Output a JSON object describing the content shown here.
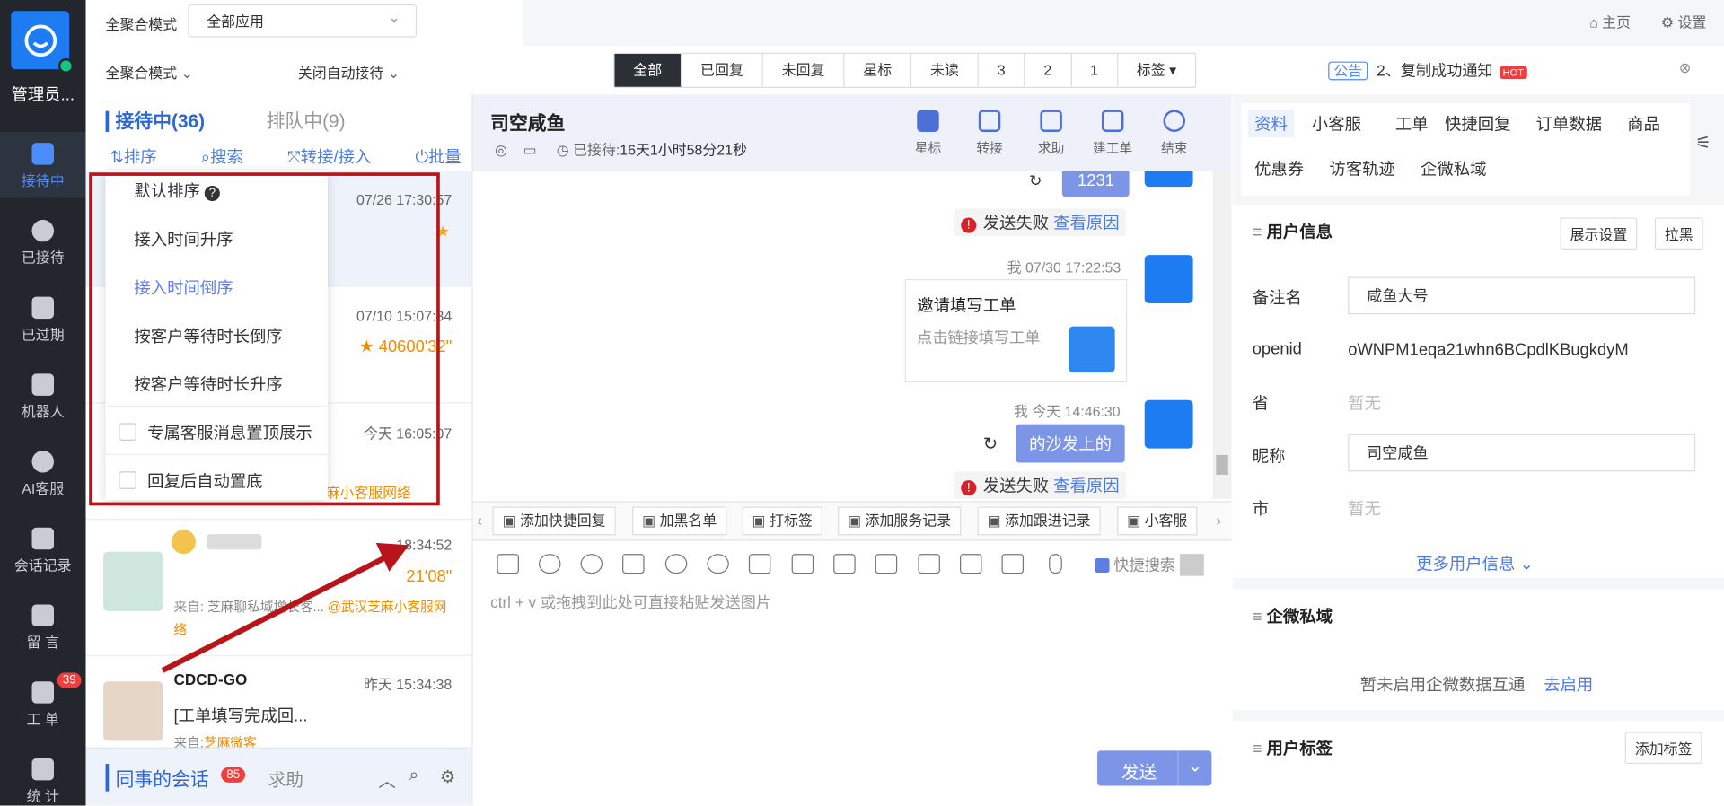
{
  "nav": {
    "admin": "管理员...",
    "items": [
      "接待中",
      "已接待",
      "已过期",
      "机器人",
      "AI客服",
      "会话记录",
      "留 言",
      "工 单",
      "统 计"
    ],
    "badge": "39"
  },
  "top": {
    "mode_label": "全聚合模式",
    "app_select": "全部应用",
    "home": "主页",
    "settings": "设置"
  },
  "row2": {
    "mode": "全聚合模式",
    "auto": "关闭自动接待",
    "filters": [
      "全部",
      "已回复",
      "未回复",
      "星标",
      "未读",
      "3",
      "2",
      "1",
      "标签 ▾"
    ],
    "notice_tag": "公告",
    "notice_text": "2、复制成功通知",
    "notice_hot": "HOT"
  },
  "list": {
    "tab_active": "接待中(36)",
    "tab_queue": "排队中(9)",
    "tools": [
      "排序",
      "搜索",
      "转接/接入",
      "批量结束"
    ],
    "sessions": [
      {
        "time": "07/26 17:30:57"
      },
      {
        "time": "07/10 15:07:34",
        "extra": "40600'32\""
      },
      {
        "time": "今天 16:05:07",
        "src_tail": "麻小客服网络"
      },
      {
        "time": "18:34:52",
        "extra": "21'08\"",
        "src": "来自: 芝麻聊私域增长客...",
        "src_org": "@武汉芝麻小客服网络"
      },
      {
        "time": "昨天 15:34:38",
        "name": "CDCD-GO",
        "snippet": "[工单填写完成回...",
        "src": "来自:",
        "src_org": "芝麻微客"
      }
    ],
    "footer_active": "同事的会话",
    "footer_badge": "85",
    "footer_help": "求助"
  },
  "menu": {
    "items": [
      "默认排序",
      "接入时间升序",
      "接入时间倒序",
      "按客户等待时长倒序",
      "按客户等待时长升序"
    ],
    "checks": [
      "专属客服消息置顶展示",
      "回复后自动置底"
    ]
  },
  "chat": {
    "name": "司空咸鱼",
    "received": "已接待:",
    "duration": "16天1小时58分21秒",
    "actions": [
      "星标",
      "转接",
      "求助",
      "建工单",
      "结束"
    ],
    "msg1": "1231",
    "fail": "发送失败",
    "fail_link": "查看原因",
    "meta2": "我  07/30 17:22:53",
    "card_title": "邀请填写工单",
    "card_sub": "点击链接填写工单",
    "meta3": "我  今天 14:46:30",
    "msg3": "的沙发上的",
    "quick": [
      "添加快捷回复",
      "加黑名单",
      "打标签",
      "添加服务记录",
      "添加跟进记录",
      "小客服"
    ],
    "quick_search": "快捷搜索",
    "placeholder": "ctrl + v 或拖拽到此处可直接粘贴发送图片",
    "send": "发送"
  },
  "right": {
    "tabs1": [
      "资料",
      "小客服",
      "工单",
      "快捷回复",
      "订单数据",
      "商品"
    ],
    "tabs2": [
      "优惠券",
      "访客轨迹",
      "企微私域"
    ],
    "user_info": "用户信息",
    "show_settings": "展示设置",
    "blacklist": "拉黑",
    "fields": {
      "remark_label": "备注名",
      "remark": "咸鱼大号",
      "openid_label": "openid",
      "openid": "oWNPM1eqa21whn6BCpdlKBugkdyM",
      "province_label": "省",
      "province": "暂无",
      "nick_label": "昵称",
      "nick": "司空咸鱼",
      "city_label": "市",
      "city": "暂无"
    },
    "more": "更多用户信息 ⌄",
    "wecom": "企微私域",
    "wecom_msg": "暂未启用企微数据互通",
    "wecom_link": "去启用",
    "tags": "用户标签",
    "add_tag": "添加标签"
  }
}
